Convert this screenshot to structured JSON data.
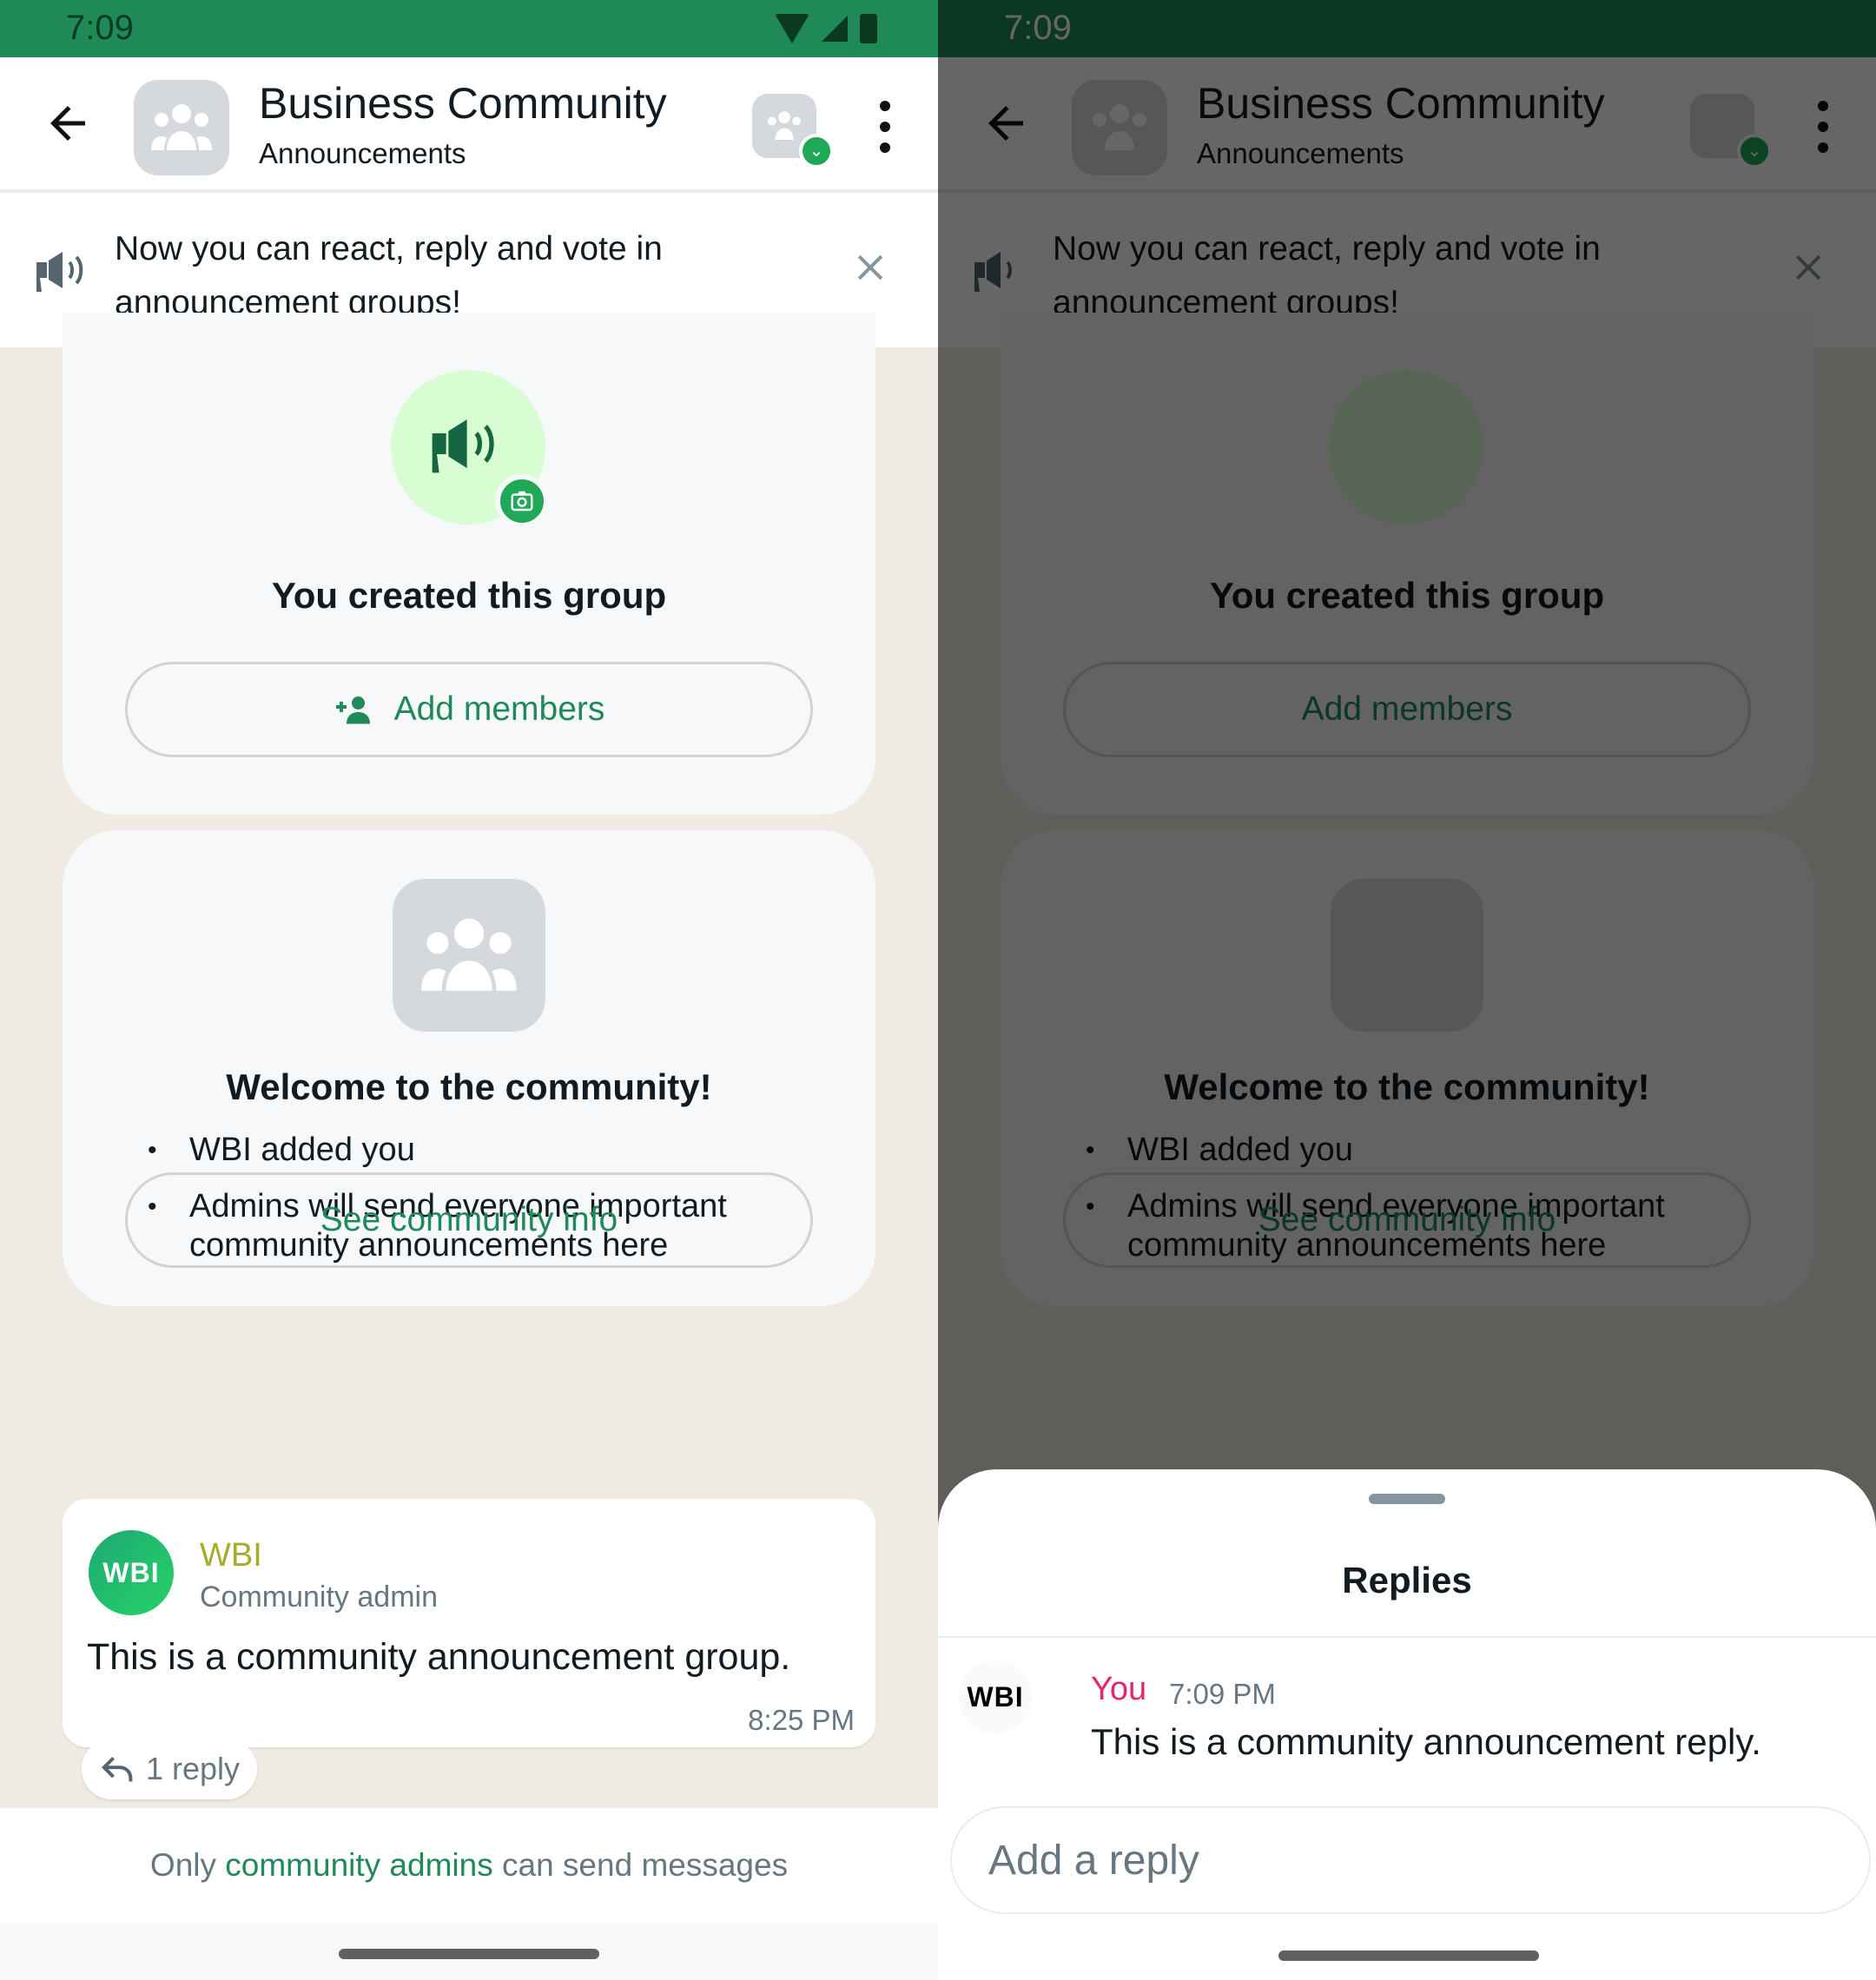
{
  "status_bar": {
    "time": "7:09"
  },
  "header": {
    "title": "Business Community",
    "subtitle": "Announcements",
    "icons": {
      "back": "arrow-left-icon",
      "avatar": "group-icon",
      "community": "community-icon",
      "more": "more-vert-icon"
    }
  },
  "banner": {
    "icon": "megaphone-icon",
    "text": "Now you can react, reply and vote in announcement groups!",
    "close_icon": "close-icon"
  },
  "created_card": {
    "heading": "You created this group",
    "add_members_label": "Add members",
    "icons": {
      "avatar": "megaphone-icon",
      "badge": "camera-icon",
      "button": "person-add-icon"
    }
  },
  "welcome_card": {
    "heading": "Welcome to the community!",
    "bullets": [
      "WBI added you",
      "Admins will send everyone important community announcements here"
    ],
    "button_label": "See community info"
  },
  "message": {
    "avatar_text": "WBI",
    "sender": "WBI",
    "role": "Community admin",
    "text": "This is a community announcement group.",
    "time": "8:25 PM",
    "replies_label": "1 reply"
  },
  "footer": {
    "prefix": "Only ",
    "accent": "community admins",
    "suffix": " can send messages"
  },
  "replies_sheet": {
    "title": "Replies",
    "reply": {
      "avatar_text": "WBI",
      "author": "You",
      "time": "7:09 PM",
      "text": "This is a community announcement reply."
    },
    "input_placeholder": "Add a reply"
  },
  "colors": {
    "brand_green": "#1f8a57",
    "status_bar": "#1f8a57",
    "badge_green": "#1fa855",
    "sender_name": "#a4ac2a",
    "reply_author": "#e5246f",
    "chat_bg": "#efeae2"
  }
}
